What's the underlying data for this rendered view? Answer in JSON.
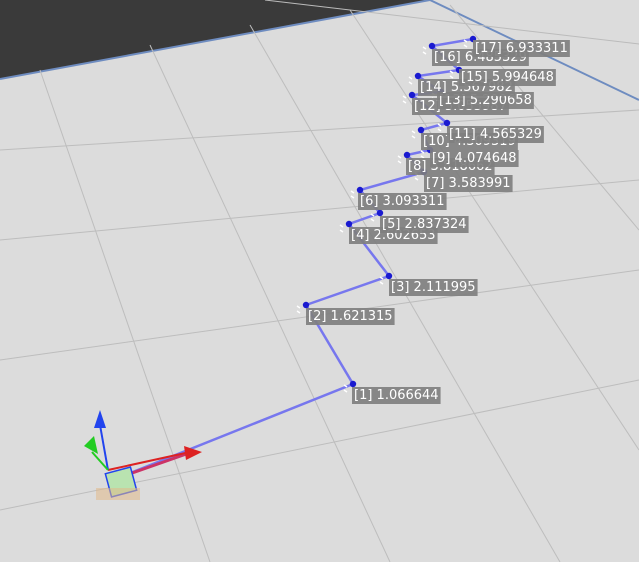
{
  "viewport": {
    "name": "3D scene viewport",
    "colors": {
      "background_far": "#3a3a3a",
      "floor": "#dcdcdc",
      "floor_edge": "#6e8cc0",
      "grid_line": "#bdbdbd",
      "path_line": "#7777ee",
      "path_node": "#1a1ad0",
      "label_bg": "#7f7f7f",
      "label_text": "#ffffff",
      "axis_x": "#dd2222",
      "axis_y": "#22cc22",
      "axis_z": "#2244ee",
      "axis_origin_line": "#cc3366"
    }
  },
  "waypoints": [
    {
      "id": "0",
      "label": ""
    },
    {
      "id": "1",
      "label": "[1] 1.066644"
    },
    {
      "id": "2",
      "label": "[2] 1.621315"
    },
    {
      "id": "3",
      "label": "[3] 2.111995"
    },
    {
      "id": "4",
      "label": "[4] 2.602653"
    },
    {
      "id": "5",
      "label": "[5] 2.837324"
    },
    {
      "id": "6",
      "label": "[6] 3.093311"
    },
    {
      "id": "7",
      "label": "[7] 3.583991"
    },
    {
      "id": "8",
      "label": "[8] 3.818662"
    },
    {
      "id": "9",
      "label": "[9] 4.074648"
    },
    {
      "id": "10",
      "label": "[10] 4.309319"
    },
    {
      "id": "11",
      "label": "[11] 4.565329"
    },
    {
      "id": "12",
      "label": "[12] 5.055987"
    },
    {
      "id": "13",
      "label": "[13] 5.290658"
    },
    {
      "id": "14",
      "label": "[14] 5.567982"
    },
    {
      "id": "15",
      "label": "[15] 5.994648"
    },
    {
      "id": "16",
      "label": "[16] 6.485329"
    },
    {
      "id": "17",
      "label": "[17] 6.933311"
    }
  ]
}
